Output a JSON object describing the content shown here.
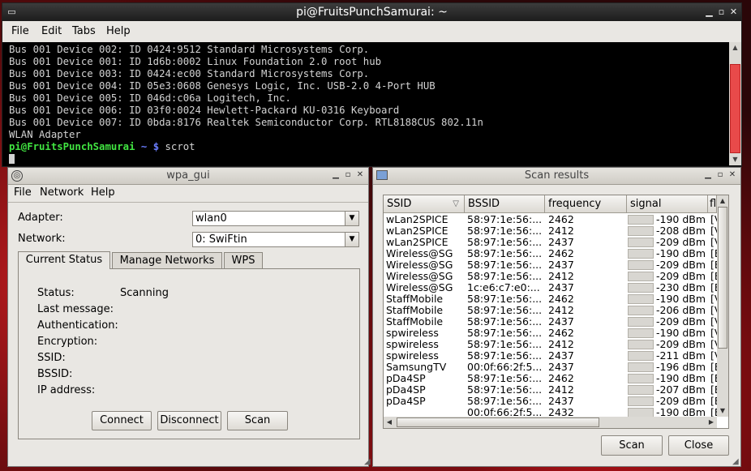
{
  "terminal": {
    "title": "pi@FruitsPunchSamurai: ~",
    "menu": [
      "File",
      "Edit",
      "Tabs",
      "Help"
    ],
    "lines": [
      "Bus 001 Device 002: ID 0424:9512 Standard Microsystems Corp.",
      "Bus 001 Device 001: ID 1d6b:0002 Linux Foundation 2.0 root hub",
      "Bus 001 Device 003: ID 0424:ec00 Standard Microsystems Corp.",
      "Bus 001 Device 004: ID 05e3:0608 Genesys Logic, Inc. USB-2.0 4-Port HUB",
      "Bus 001 Device 005: ID 046d:c06a Logitech, Inc.",
      "Bus 001 Device 006: ID 03f0:0024 Hewlett-Packard KU-0316 Keyboard",
      "Bus 001 Device 007: ID 0bda:8176 Realtek Semiconductor Corp. RTL8188CUS 802.11n",
      "WLAN Adapter"
    ],
    "prompt_user": "pi@FruitsPunchSamurai",
    "prompt_path": "~ $",
    "command": "scrot"
  },
  "wpa_gui": {
    "title": "wpa_gui",
    "menu": [
      "File",
      "Network",
      "Help"
    ],
    "adapter_label": "Adapter:",
    "adapter_value": "wlan0",
    "network_label": "Network:",
    "network_value": "0: SwiFtin",
    "tabs": [
      "Current Status",
      "Manage Networks",
      "WPS"
    ],
    "status_fields": [
      {
        "label": "Status:",
        "value": "Scanning"
      },
      {
        "label": "Last message:",
        "value": ""
      },
      {
        "label": "Authentication:",
        "value": ""
      },
      {
        "label": "Encryption:",
        "value": ""
      },
      {
        "label": "SSID:",
        "value": ""
      },
      {
        "label": "BSSID:",
        "value": ""
      },
      {
        "label": "IP address:",
        "value": ""
      }
    ],
    "buttons": [
      "Connect",
      "Disconnect",
      "Scan"
    ]
  },
  "scan_results": {
    "title": "Scan results",
    "columns": [
      "SSID",
      "BSSID",
      "frequency",
      "signal",
      "fl"
    ],
    "rows": [
      {
        "ssid": "wLan2SPICE",
        "bssid": "58:97:1e:56:...",
        "freq": "2462",
        "signal": "-190 dBm",
        "flags": "[V"
      },
      {
        "ssid": "wLan2SPICE",
        "bssid": "58:97:1e:56:...",
        "freq": "2412",
        "signal": "-208 dBm",
        "flags": "[V"
      },
      {
        "ssid": "wLan2SPICE",
        "bssid": "58:97:1e:56:...",
        "freq": "2437",
        "signal": "-209 dBm",
        "flags": "[V"
      },
      {
        "ssid": "Wireless@SG",
        "bssid": "58:97:1e:56:...",
        "freq": "2462",
        "signal": "-190 dBm",
        "flags": "[E"
      },
      {
        "ssid": "Wireless@SG",
        "bssid": "58:97:1e:56:...",
        "freq": "2437",
        "signal": "-209 dBm",
        "flags": "[E"
      },
      {
        "ssid": "Wireless@SG",
        "bssid": "58:97:1e:56:...",
        "freq": "2412",
        "signal": "-209 dBm",
        "flags": "[E"
      },
      {
        "ssid": "Wireless@SG",
        "bssid": "1c:e6:c7:e0:...",
        "freq": "2437",
        "signal": "-230 dBm",
        "flags": "[E"
      },
      {
        "ssid": "StaffMobile",
        "bssid": "58:97:1e:56:...",
        "freq": "2462",
        "signal": "-190 dBm",
        "flags": "[V"
      },
      {
        "ssid": "StaffMobile",
        "bssid": "58:97:1e:56:...",
        "freq": "2412",
        "signal": "-206 dBm",
        "flags": "[V"
      },
      {
        "ssid": "StaffMobile",
        "bssid": "58:97:1e:56:...",
        "freq": "2437",
        "signal": "-209 dBm",
        "flags": "[V"
      },
      {
        "ssid": "spwireless",
        "bssid": "58:97:1e:56:...",
        "freq": "2462",
        "signal": "-190 dBm",
        "flags": "[V"
      },
      {
        "ssid": "spwireless",
        "bssid": "58:97:1e:56:...",
        "freq": "2412",
        "signal": "-209 dBm",
        "flags": "[V"
      },
      {
        "ssid": "spwireless",
        "bssid": "58:97:1e:56:...",
        "freq": "2437",
        "signal": "-211 dBm",
        "flags": "[V"
      },
      {
        "ssid": "SamsungTV",
        "bssid": "00:0f:66:2f:5...",
        "freq": "2437",
        "signal": "-196 dBm",
        "flags": "[E"
      },
      {
        "ssid": "pDa4SP",
        "bssid": "58:97:1e:56:...",
        "freq": "2462",
        "signal": "-190 dBm",
        "flags": "[E"
      },
      {
        "ssid": "pDa4SP",
        "bssid": "58:97:1e:56:...",
        "freq": "2412",
        "signal": "-207 dBm",
        "flags": "[E"
      },
      {
        "ssid": "pDa4SP",
        "bssid": "58:97:1e:56:...",
        "freq": "2437",
        "signal": "-209 dBm",
        "flags": "[E"
      },
      {
        "ssid": "",
        "bssid": "00:0f:66:2f:5...",
        "freq": "2432",
        "signal": "-190 dBm",
        "flags": "[E"
      }
    ],
    "buttons": [
      "Scan",
      "Close"
    ]
  }
}
